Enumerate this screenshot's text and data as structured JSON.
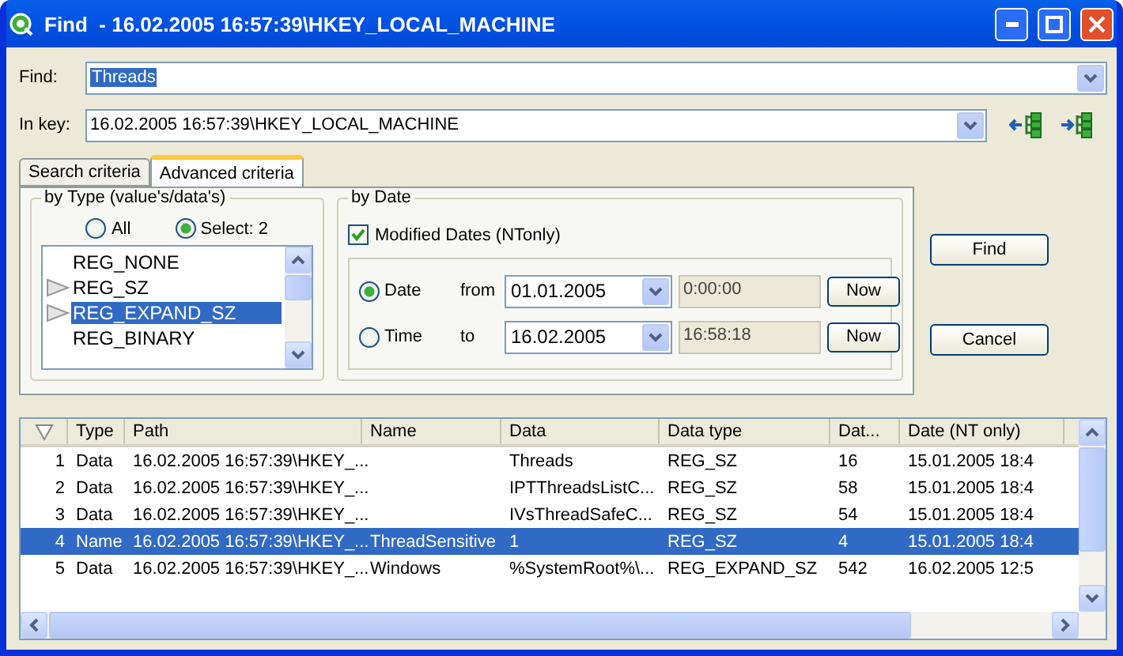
{
  "window": {
    "title": "Find  - 16.02.2005 16:57:39\\HKEY_LOCAL_MACHINE"
  },
  "find": {
    "label": "Find:",
    "value": "Threads"
  },
  "in_key": {
    "label": "In key:",
    "value": "16.02.2005 16:57:39\\HKEY_LOCAL_MACHINE"
  },
  "tabs": [
    {
      "label": "Search criteria",
      "selected": false
    },
    {
      "label": "Advanced criteria",
      "selected": true
    }
  ],
  "by_type": {
    "title": "by Type (value's/data's)",
    "options": [
      {
        "label": "All",
        "selected": false
      },
      {
        "label": "Select: 2",
        "selected": true
      }
    ],
    "types": [
      {
        "label": "REG_NONE",
        "marked": false,
        "selected": false
      },
      {
        "label": "REG_SZ",
        "marked": true,
        "selected": false
      },
      {
        "label": "REG_EXPAND_SZ",
        "marked": true,
        "selected": true
      },
      {
        "label": "REG_BINARY",
        "marked": false,
        "selected": false
      }
    ]
  },
  "by_date": {
    "title": "by Date",
    "modified": {
      "label": "Modified Dates (NTonly)",
      "checked": true
    },
    "modes": [
      {
        "label": "Date",
        "selected": true
      },
      {
        "label": "Time",
        "selected": false
      }
    ],
    "ranges": [
      {
        "label": "from",
        "date": "01.01.2005",
        "time": "0:00:00",
        "button": "Now"
      },
      {
        "label": "to",
        "date": "16.02.2005",
        "time": "16:58:18",
        "button": "Now"
      }
    ]
  },
  "buttons": [
    "Find",
    "Cancel"
  ],
  "results": {
    "columns": [
      "",
      "Type",
      "Path",
      "Name",
      "Data",
      "Data type",
      "Dat...",
      "Date (NT only)"
    ],
    "rows": [
      {
        "cells": [
          "1",
          "Data",
          "16.02.2005 16:57:39\\HKEY_...",
          "",
          "Threads",
          "REG_SZ",
          "16",
          "15.01.2005 18:4"
        ],
        "selected": false
      },
      {
        "cells": [
          "2",
          "Data",
          "16.02.2005 16:57:39\\HKEY_...",
          "",
          "IPTThreadsListC...",
          "REG_SZ",
          "58",
          "15.01.2005 18:4"
        ],
        "selected": false
      },
      {
        "cells": [
          "3",
          "Data",
          "16.02.2005 16:57:39\\HKEY_...",
          "",
          "IVsThreadSafeC...",
          "REG_SZ",
          "54",
          "15.01.2005 18:4"
        ],
        "selected": false
      },
      {
        "cells": [
          "4",
          "Name",
          "16.02.2005 16:57:39\\HKEY_...",
          "ThreadSensitive",
          "1",
          "REG_SZ",
          "4",
          "15.01.2005 18:4"
        ],
        "selected": true
      },
      {
        "cells": [
          "5",
          "Data",
          "16.02.2005 16:57:39\\HKEY_...",
          "Windows",
          "%SystemRoot%\\...",
          "REG_EXPAND_SZ",
          "542",
          "16.02.2005 12:5"
        ],
        "selected": false
      }
    ]
  }
}
